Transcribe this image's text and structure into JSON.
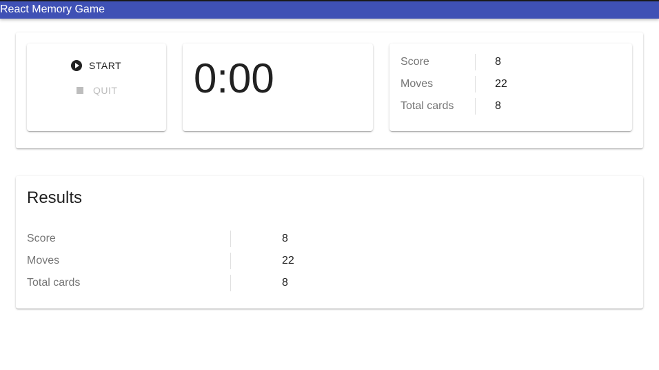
{
  "appbar": {
    "title": "React Memory Game",
    "color": "#3f51b5"
  },
  "controls": {
    "start_label": "START",
    "quit_label": "QUIT",
    "start_icon": "play-circle-icon",
    "quit_icon": "stop-icon"
  },
  "timer": {
    "value": "0:00"
  },
  "stats": {
    "rows": [
      {
        "label": "Score",
        "value": "8"
      },
      {
        "label": "Moves",
        "value": "22"
      },
      {
        "label": "Total cards",
        "value": "8"
      }
    ]
  },
  "results": {
    "title": "Results",
    "rows": [
      {
        "label": "Score",
        "value": "8"
      },
      {
        "label": "Moves",
        "value": "22"
      },
      {
        "label": "Total cards",
        "value": "8"
      }
    ]
  }
}
